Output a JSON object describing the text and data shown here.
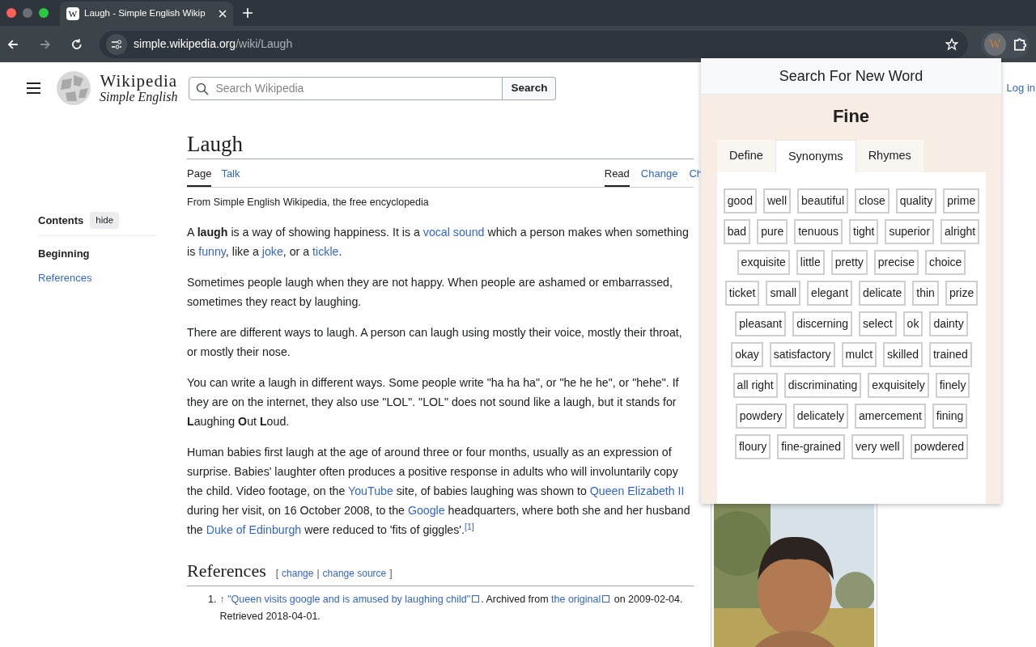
{
  "browser": {
    "favicon_letter": "W",
    "extension_letter": "W",
    "tab_title": "Laugh - Simple English Wikip",
    "url_host": "simple.wikipedia.org",
    "url_path": "/wiki/Laugh"
  },
  "site": {
    "wordmark": "Wikipedia",
    "tagline": "Simple English",
    "search_placeholder": "Search Wikipedia",
    "search_button": "Search",
    "login": "Log in"
  },
  "contents": {
    "title": "Contents",
    "hide": "hide",
    "items": [
      {
        "label": "Beginning",
        "selected": true
      },
      {
        "label": "References",
        "selected": false
      }
    ]
  },
  "article": {
    "title": "Laugh",
    "left_tabs": [
      {
        "label": "Page",
        "selected": true
      },
      {
        "label": "Talk",
        "selected": false
      }
    ],
    "right_tabs": [
      {
        "label": "Read",
        "selected": true
      },
      {
        "label": "Change",
        "selected": false
      },
      {
        "label": "Ch",
        "selected": false
      }
    ],
    "subtitle": "From Simple English Wikipedia, the free encyclopedia",
    "paragraphs": [
      [
        {
          "kind": "text",
          "text": "A "
        },
        {
          "kind": "bold",
          "text": "laugh"
        },
        {
          "kind": "text",
          "text": " is a way of showing happiness. It is a "
        },
        {
          "kind": "link",
          "text": "vocal sound"
        },
        {
          "kind": "text",
          "text": " which a person makes when something is "
        },
        {
          "kind": "link",
          "text": "funny"
        },
        {
          "kind": "text",
          "text": ", like a "
        },
        {
          "kind": "link",
          "text": "joke"
        },
        {
          "kind": "text",
          "text": ", or a "
        },
        {
          "kind": "link",
          "text": "tickle"
        },
        {
          "kind": "text",
          "text": "."
        }
      ],
      [
        {
          "kind": "text",
          "text": "Sometimes people laugh when they are not happy. When people are ashamed or embarrassed, sometimes they react by laughing."
        }
      ],
      [
        {
          "kind": "text",
          "text": "There are different ways to laugh. A person can laugh using mostly their voice, mostly their throat, or mostly their nose."
        }
      ],
      [
        {
          "kind": "text",
          "text": "You can write a laugh in different ways. Some people write \"ha ha ha\", or \"he he he\", or \"hehe\". If they are on the internet, they also use \"LOL\". \"LOL\" does not sound like a laugh, but it stands for "
        },
        {
          "kind": "bold",
          "text": "L"
        },
        {
          "kind": "text",
          "text": "aughing "
        },
        {
          "kind": "bold",
          "text": "O"
        },
        {
          "kind": "text",
          "text": "ut "
        },
        {
          "kind": "bold",
          "text": "L"
        },
        {
          "kind": "text",
          "text": "oud."
        }
      ],
      [
        {
          "kind": "text",
          "text": "Human babies first laugh at the age of around three or four months, usually as an expression of surprise. Babies' laughter often produces a positive response in adults who will involuntarily copy the child. Video footage, on the "
        },
        {
          "kind": "link",
          "text": "YouTube"
        },
        {
          "kind": "text",
          "text": " site, of babies laughing was shown to "
        },
        {
          "kind": "link",
          "text": "Queen Elizabeth II"
        },
        {
          "kind": "text",
          "text": " during her visit, on 16 October 2008, to the "
        },
        {
          "kind": "link",
          "text": "Google"
        },
        {
          "kind": "text",
          "text": " headquarters, where both she and her husband the "
        },
        {
          "kind": "link",
          "text": "Duke of Edinburgh"
        },
        {
          "kind": "text",
          "text": " were reduced to 'fits of giggles'."
        },
        {
          "kind": "sup",
          "text": "[1]"
        }
      ]
    ],
    "references": {
      "title": "References",
      "open": "[",
      "change": "change",
      "sep": "|",
      "change_source": "change source",
      "close": "]",
      "items": [
        {
          "number": "1.",
          "arrow": "↑",
          "link": "\"Queen visits google and is amused by laughing child\"",
          "mid": ". Archived from ",
          "link2": "the original",
          "end": " on 2009-02-04. Retrieved 2018-04-01."
        }
      ]
    }
  },
  "popup": {
    "header": "Search For New Word",
    "word": "Fine",
    "tabs": [
      {
        "label": "Define",
        "selected": false
      },
      {
        "label": "Synonyms",
        "selected": true
      },
      {
        "label": "Rhymes",
        "selected": false
      }
    ],
    "words": [
      "good",
      "well",
      "beautiful",
      "close",
      "quality",
      "prime",
      "bad",
      "pure",
      "tenuous",
      "tight",
      "superior",
      "alright",
      "exquisite",
      "little",
      "pretty",
      "precise",
      "choice",
      "ticket",
      "small",
      "elegant",
      "delicate",
      "thin",
      "prize",
      "pleasant",
      "discerning",
      "select",
      "ok",
      "dainty",
      "okay",
      "satisfactory",
      "mulct",
      "skilled",
      "trained",
      "all right",
      "discriminating",
      "exquisitely",
      "finely",
      "powdery",
      "delicately",
      "amercement",
      "fining",
      "floury",
      "fine-grained",
      "very well",
      "powdered"
    ]
  }
}
